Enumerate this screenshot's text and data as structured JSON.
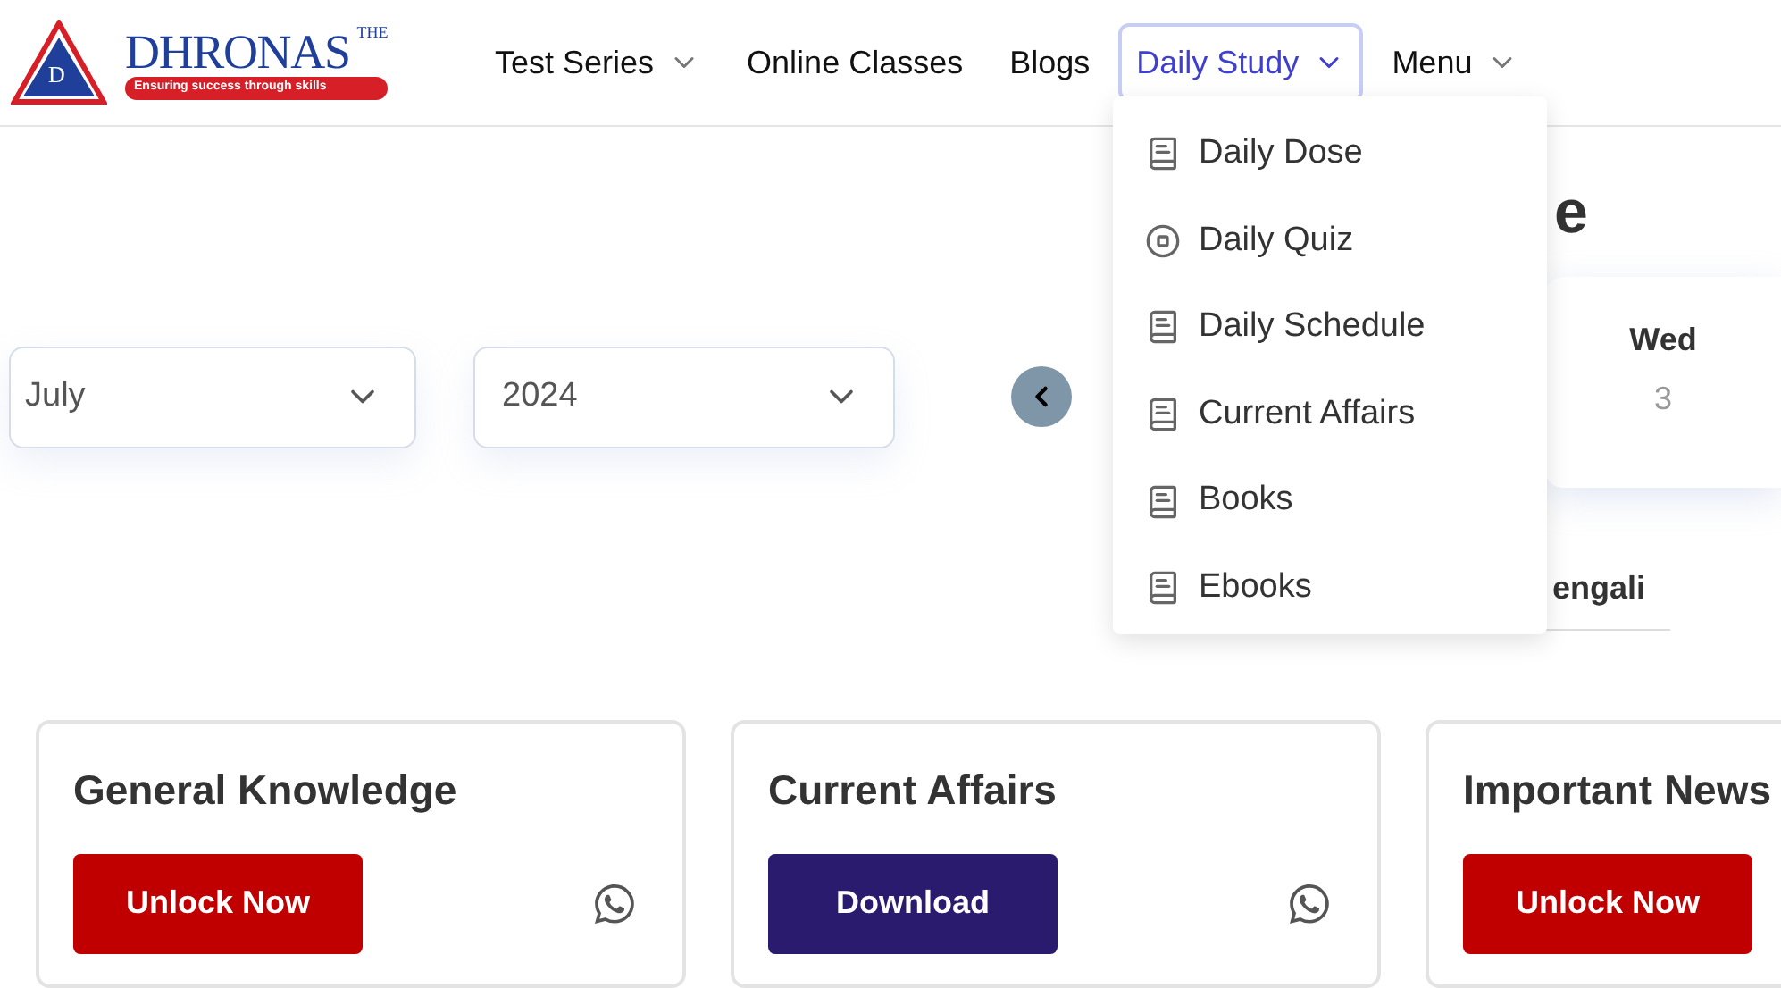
{
  "logo": {
    "mark": "D",
    "small": "THE",
    "name": "DHRONAS",
    "tagline": "Ensuring success through skills"
  },
  "nav": [
    {
      "label": "Test Series",
      "has_menu": true,
      "selected": false
    },
    {
      "label": "Online Classes",
      "has_menu": false,
      "selected": false
    },
    {
      "label": "Blogs",
      "has_menu": false,
      "selected": false
    },
    {
      "label": "Daily Study",
      "has_menu": true,
      "selected": true
    },
    {
      "label": "Menu",
      "has_menu": true,
      "selected": false
    }
  ],
  "dropdown": [
    {
      "label": "Daily Dose",
      "kind": "book"
    },
    {
      "label": "Daily Quiz",
      "kind": "quiz"
    },
    {
      "label": "Daily Schedule",
      "kind": "book"
    },
    {
      "label": "Current Affairs",
      "kind": "book"
    },
    {
      "label": "Books",
      "kind": "book"
    },
    {
      "label": "Ebooks",
      "kind": "book"
    }
  ],
  "heading": "e",
  "month_select": {
    "value": "July"
  },
  "year_select": {
    "value": "2024"
  },
  "calendar": {
    "day": "Wed",
    "date": "3"
  },
  "language_tab": {
    "label": "engali"
  },
  "cards": [
    {
      "title": "General Knowledge",
      "button": "Unlock Now",
      "kind": "unlock"
    },
    {
      "title": "Current Affairs",
      "button": "Download",
      "kind": "download"
    },
    {
      "title": "Important News",
      "button": "Unlock Now",
      "kind": "unlock"
    }
  ]
}
